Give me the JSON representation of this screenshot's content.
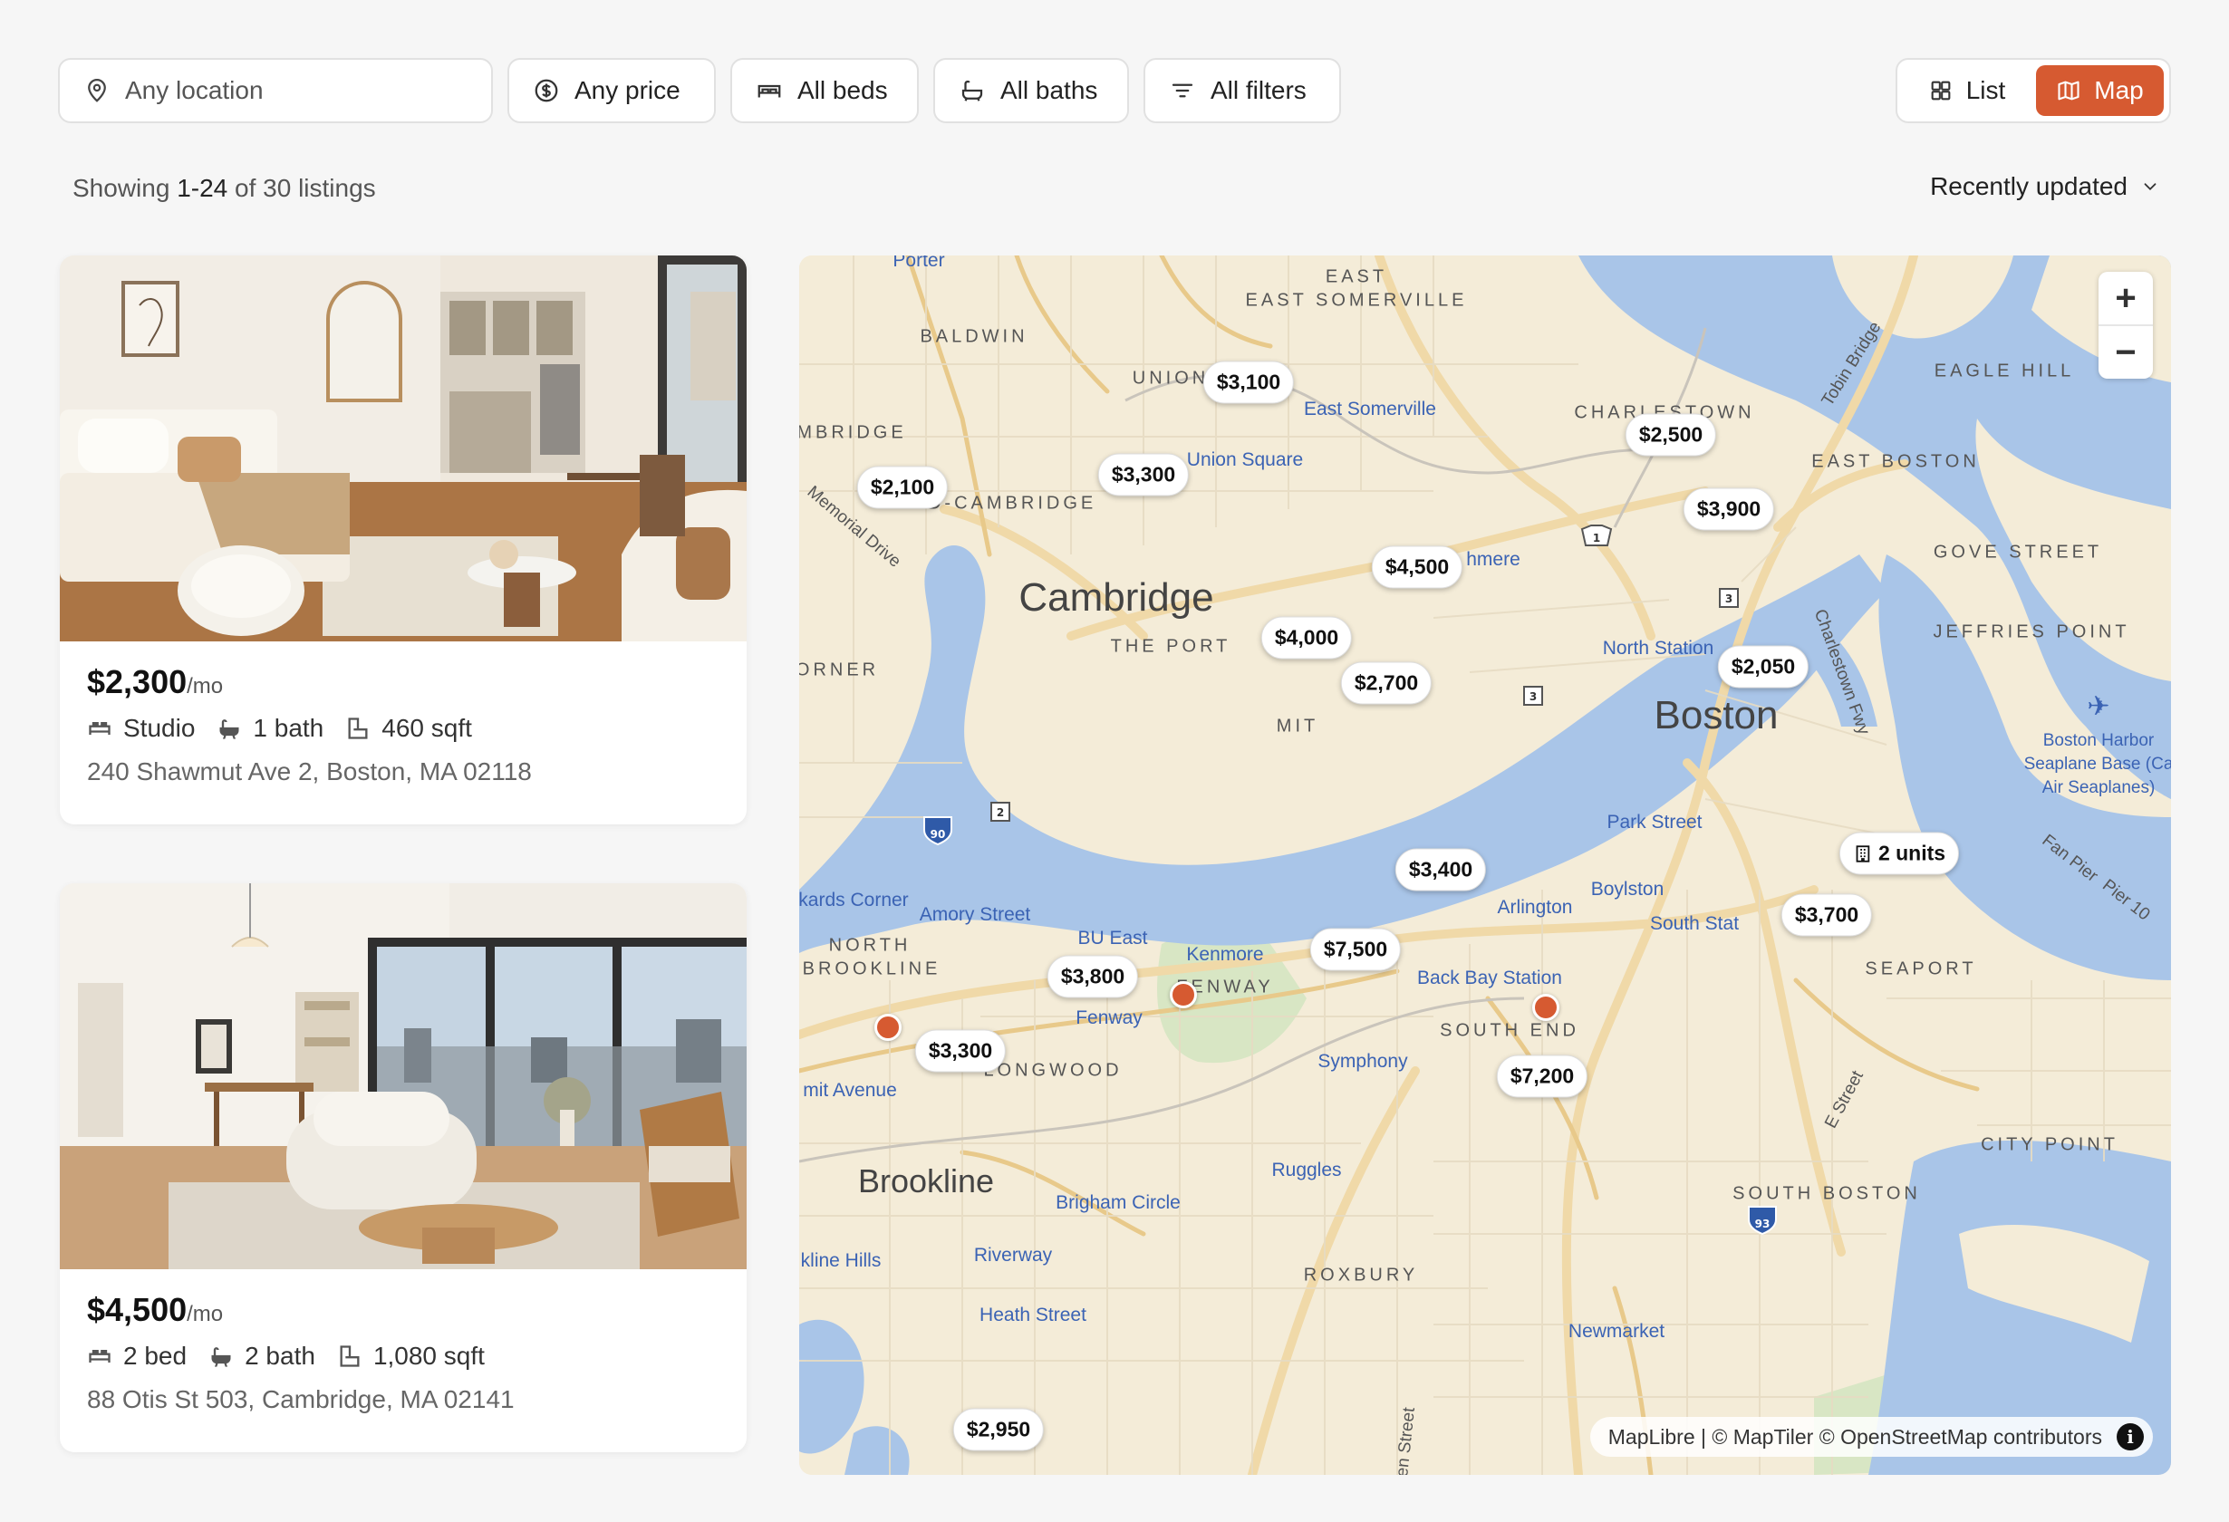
{
  "filters": {
    "location_placeholder": "Any location",
    "price": "Any price",
    "beds": "All beds",
    "baths": "All baths",
    "more": "All filters"
  },
  "view_toggle": {
    "list": "List",
    "map": "Map",
    "active": "map"
  },
  "results": {
    "count_prefix": "Showing ",
    "count_range": "1-24",
    "count_suffix": " of 30 listings",
    "sort": "Recently updated"
  },
  "listings": [
    {
      "price": "$2,300",
      "unit": "/mo",
      "beds": "Studio",
      "baths": "1 bath",
      "sqft": "460 sqft",
      "address": "240 Shawmut Ave 2, Boston, MA 02118"
    },
    {
      "price": "$4,500",
      "unit": "/mo",
      "beds": "2 bed",
      "baths": "2 bath",
      "sqft": "1,080 sqft",
      "address": "88 Otis St 503, Cambridge, MA 02141"
    }
  ],
  "map": {
    "cities": [
      {
        "name": "Cambridge"
      },
      {
        "name": "Boston"
      },
      {
        "name": "Brookline"
      }
    ],
    "neighborhoods": [
      "EAST SOMERVILLE",
      "BALDWIN",
      "UNION",
      "CHARLESTOWN",
      "EAGLE HILL",
      "EAST BOSTON",
      "MID-CAMBRIDGE",
      "GOVE STREET",
      "JEFFRIES POINT",
      "THE PORT",
      "MIT",
      "NORTH BROOKLINE",
      "FENWAY",
      "LONGWOOD",
      "SOUTH END",
      "SEAPORT",
      "ROXBURY",
      "SOUTH BOSTON",
      "CITY POINT",
      "MBRIDGE",
      "ORNER"
    ],
    "stops": [
      "Porter",
      "East Somerville",
      "Union Square",
      "North Station",
      "Park Street",
      "Boylston",
      "Arlington",
      "Kenmore",
      "BU East",
      "Amory Street",
      "Fenway",
      "Back Bay Station",
      "Symphony",
      "Ruggles",
      "Brigham Circle",
      "Riverway",
      "Heath Street",
      "Newmarket",
      "South Stat",
      "kline Hills",
      "mit Avenue",
      "kards Corner",
      "hmere",
      "Boston Harbor",
      "Seaplane Base (Ca",
      "Air Seaplanes)"
    ],
    "roads": [
      "Memorial Drive",
      "Tobin Bridge",
      "Charlestown Fwy",
      "E Street",
      "Fan Pier",
      "Pier 10",
      "en Street"
    ],
    "shields": [
      "1",
      "3",
      "3",
      "2",
      "90",
      "93"
    ],
    "pins": [
      {
        "label": "$3,100"
      },
      {
        "label": "$3,300"
      },
      {
        "label": "$2,100"
      },
      {
        "label": "$2,500"
      },
      {
        "label": "$3,900"
      },
      {
        "label": "$4,500"
      },
      {
        "label": "$4,000"
      },
      {
        "label": "$2,700"
      },
      {
        "label": "$2,050"
      },
      {
        "label": "$3,400"
      },
      {
        "label": "2 units"
      },
      {
        "label": "$3,700"
      },
      {
        "label": "$7,500"
      },
      {
        "label": "$3,800"
      },
      {
        "label": "$3,300"
      },
      {
        "label": "$7,200"
      },
      {
        "label": "$2,950"
      }
    ],
    "zoom_in": "+",
    "zoom_out": "−",
    "attribution": "MapLibre | © MapTiler © OpenStreetMap contributors",
    "info_icon": "i"
  },
  "colors": {
    "accent": "#d65a31",
    "water": "#a9c5e8",
    "land": "#f4ecd8",
    "transit": "#3b63b4"
  }
}
